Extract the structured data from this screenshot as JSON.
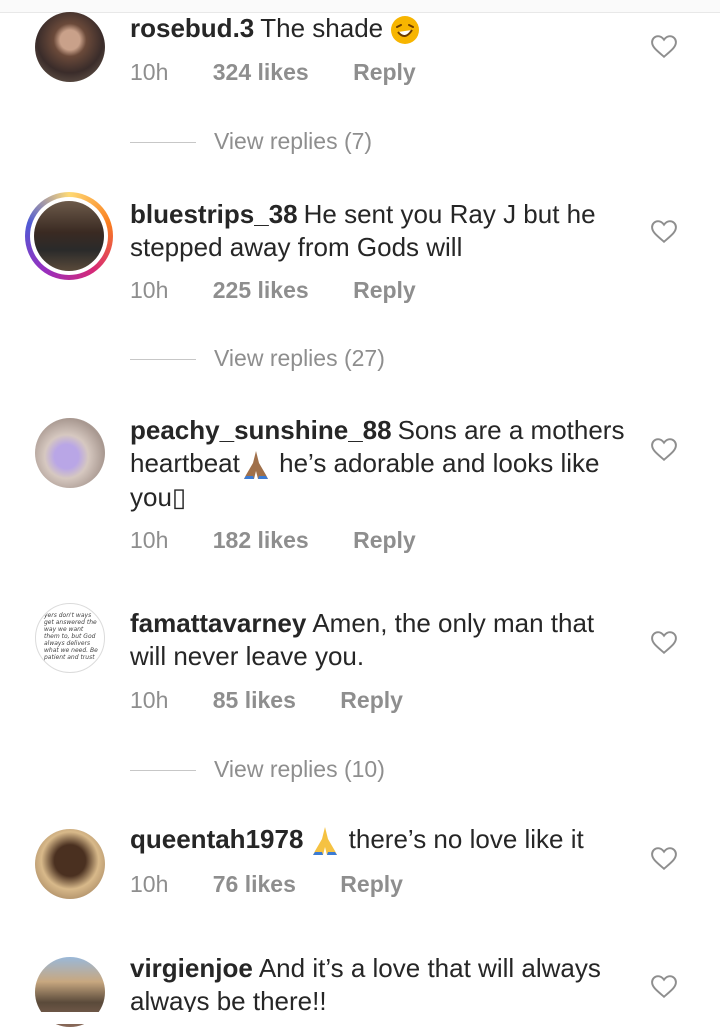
{
  "comments": [
    {
      "username": "rosebud.3",
      "text": "The shade",
      "time": "10h",
      "likes": "324 likes",
      "reply": "Reply",
      "view_replies": "View replies (7)"
    },
    {
      "username": "bluestrips_38",
      "text": "He sent you Ray J but he stepped away from Gods will",
      "time": "10h",
      "likes": "225 likes",
      "reply": "Reply",
      "view_replies": "View replies (27)"
    },
    {
      "username": "peachy_sunshine_88",
      "text_a": "Sons are a mothers heartbeat",
      "text_b": "he’s adorable and looks like you",
      "tail": "▯",
      "time": "10h",
      "likes": "182 likes",
      "reply": "Reply"
    },
    {
      "username": "famattavarney",
      "text": "Amen, the only man that will never leave you.",
      "time": "10h",
      "likes": "85 likes",
      "reply": "Reply",
      "view_replies": "View replies (10)"
    },
    {
      "username": "queentah1978",
      "text": "there’s no love like it",
      "time": "10h",
      "likes": "76 likes",
      "reply": "Reply"
    },
    {
      "username": "virgienjoe",
      "text": "And it’s a love that will always always be there!!"
    }
  ],
  "avatar_quote_text": "yers don't ways get answered the way we want them to, but God always delivers what we need. Be patient and trust",
  "colors": {
    "meta": "#8e8e8e",
    "text": "#262626",
    "line": "#c7c7c7"
  },
  "icons": {
    "like": "heart-outline-icon",
    "laugh_emoji": "laughing-face-emoji",
    "pray_emoji": "praying-hands-emoji"
  }
}
